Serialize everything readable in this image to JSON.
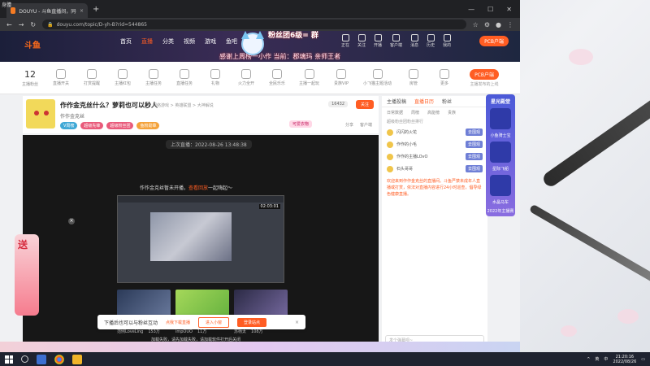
{
  "browser": {
    "tab_title": "DOUYU - 斗鱼直播间，同看惊爆",
    "url": "douyu.com/topic/D-yh-B?rid=544865",
    "corner_label": "身體"
  },
  "header": {
    "logo": "斗鱼",
    "nav": [
      "首页",
      "直播",
      "分类",
      "视频",
      "游戏",
      "鱼吧"
    ],
    "overlay_line1": "感谢上周榜一小作  当前：郡璃玛 亲师王者",
    "overlay_line2": "粉丝团6级=  群",
    "icons": [
      "正在",
      "关注",
      "开播",
      "客户端",
      "消息",
      "历史",
      "我的"
    ],
    "pcb_label": "PCB户端"
  },
  "toolbar": {
    "count": "12",
    "items": [
      "主播粉丝",
      "直播开关",
      "打赏提醒",
      "主播红包",
      "主播任务",
      "直播任务",
      "礼物",
      "火力全开",
      "全民乐乐",
      "主播一起玩",
      "贵族VIP",
      "小飞猫主题活动",
      "房管",
      "更多"
    ],
    "pcb_button": "PCB户端",
    "pcb_sub": "主播发布的上线"
  },
  "stream": {
    "title": "作作金克丝什么？萝莉也可以秒人",
    "breadcrumb": "网络游戏 > 英雄联盟 > 大神解说",
    "host": "作作金克丝",
    "tags": [
      "V周榜",
      "超级先锋",
      "超级粉丝团",
      "鱼粉勋章"
    ],
    "level_badge": "可爱衣物",
    "report": "16432",
    "follow": "关注",
    "share_items": [
      "分享",
      "客户端"
    ],
    "start_time": "上次直播：2022-08-26 13:48:38",
    "notice_prefix": "作作金克丝暂未开播，",
    "notice_highlight": "查看回放",
    "notice_suffix": "一起嗨起～",
    "video_timer": "02:03:01",
    "ad_note": "加载失败，请先加载失败，请加载软件打开后关闭"
  },
  "thumbs": [
    {
      "name": "范例LoveLing",
      "count": "153万"
    },
    {
      "name": "impOUO",
      "count": "11万"
    },
    {
      "name": "苏杨太",
      "count": "108万"
    }
  ],
  "gift": {
    "label": "送",
    "close": "×"
  },
  "popup": {
    "text": "下播后也可以与粉丝互动",
    "tip": "点我下载直播",
    "btn_ghost": "进入小窗",
    "btn_solid": "登录站点",
    "close": "×"
  },
  "chat": {
    "tabs": [
      "主播投稿",
      "直播日历",
      "粉丝"
    ],
    "sub_tabs": [
      "日常数据",
      "周榜",
      "高能榜",
      "贵族"
    ],
    "rank_head": "超级粉丝团粉丝排行",
    "rank_rows": [
      {
        "name": "闪闪的火花",
        "go": "去围观"
      },
      {
        "name": "作作的小毛",
        "go": "去围观"
      },
      {
        "name": "作作的主播LOvO",
        "go": "去围观"
      },
      {
        "name": "石头哥哥",
        "go": "去围观"
      }
    ],
    "notice": "欢迎来到作作金克丝的直播间。斗鱼严禁未成年人直播或打赏，依法对直播内容进行24小时巡查，倡导绿色健康直播。",
    "input_placeholder": "发个弹幕呗~"
  },
  "side_ad": {
    "title": "星光殿堂",
    "cells": [
      "小鱼骑士宝",
      "星际飞船",
      "水晶马车"
    ],
    "foot": "2022年主播赛"
  },
  "taskbar": {
    "tray": [
      "英",
      "中"
    ],
    "time": "21:20:16",
    "date": "2022/08/26"
  },
  "colors": {
    "accent": "#ff5d23",
    "header": "#1b1f3a"
  }
}
